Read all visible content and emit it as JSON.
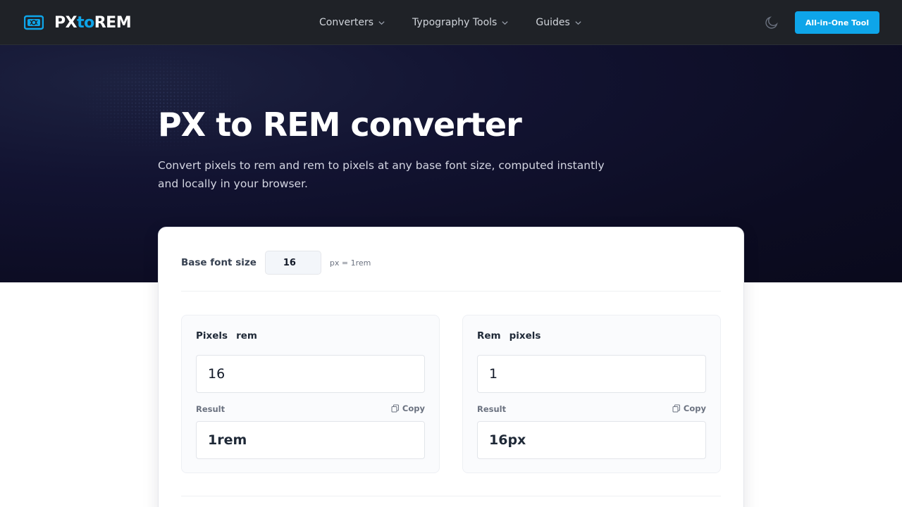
{
  "header": {
    "logo": {
      "prefix": "PX",
      "middle": "to",
      "suffix": "REM"
    },
    "nav": [
      {
        "label": "Converters"
      },
      {
        "label": "Typography Tools"
      },
      {
        "label": "Guides"
      }
    ],
    "cta_label": "All-in-One Tool"
  },
  "hero": {
    "title": "PX to REM converter",
    "subtitle": "Convert pixels to rem and rem to pixels at any base font size, computed instantly and locally in your browser."
  },
  "converter": {
    "base_label": "Base font size",
    "base_value": "16",
    "base_unit": "px = 1rem",
    "px_to_rem": {
      "title_from": "Pixels",
      "title_to": "rem",
      "input_value": "16",
      "result_label": "Result",
      "copy_label": "Copy",
      "result_value": "1rem"
    },
    "rem_to_px": {
      "title_from": "Rem",
      "title_to": "pixels",
      "input_value": "1",
      "result_label": "Result",
      "copy_label": "Copy",
      "result_value": "16px"
    }
  },
  "colors": {
    "accent": "#0ea5e9",
    "header_bg": "#1f2227",
    "hero_bg": "#0c0c22"
  }
}
